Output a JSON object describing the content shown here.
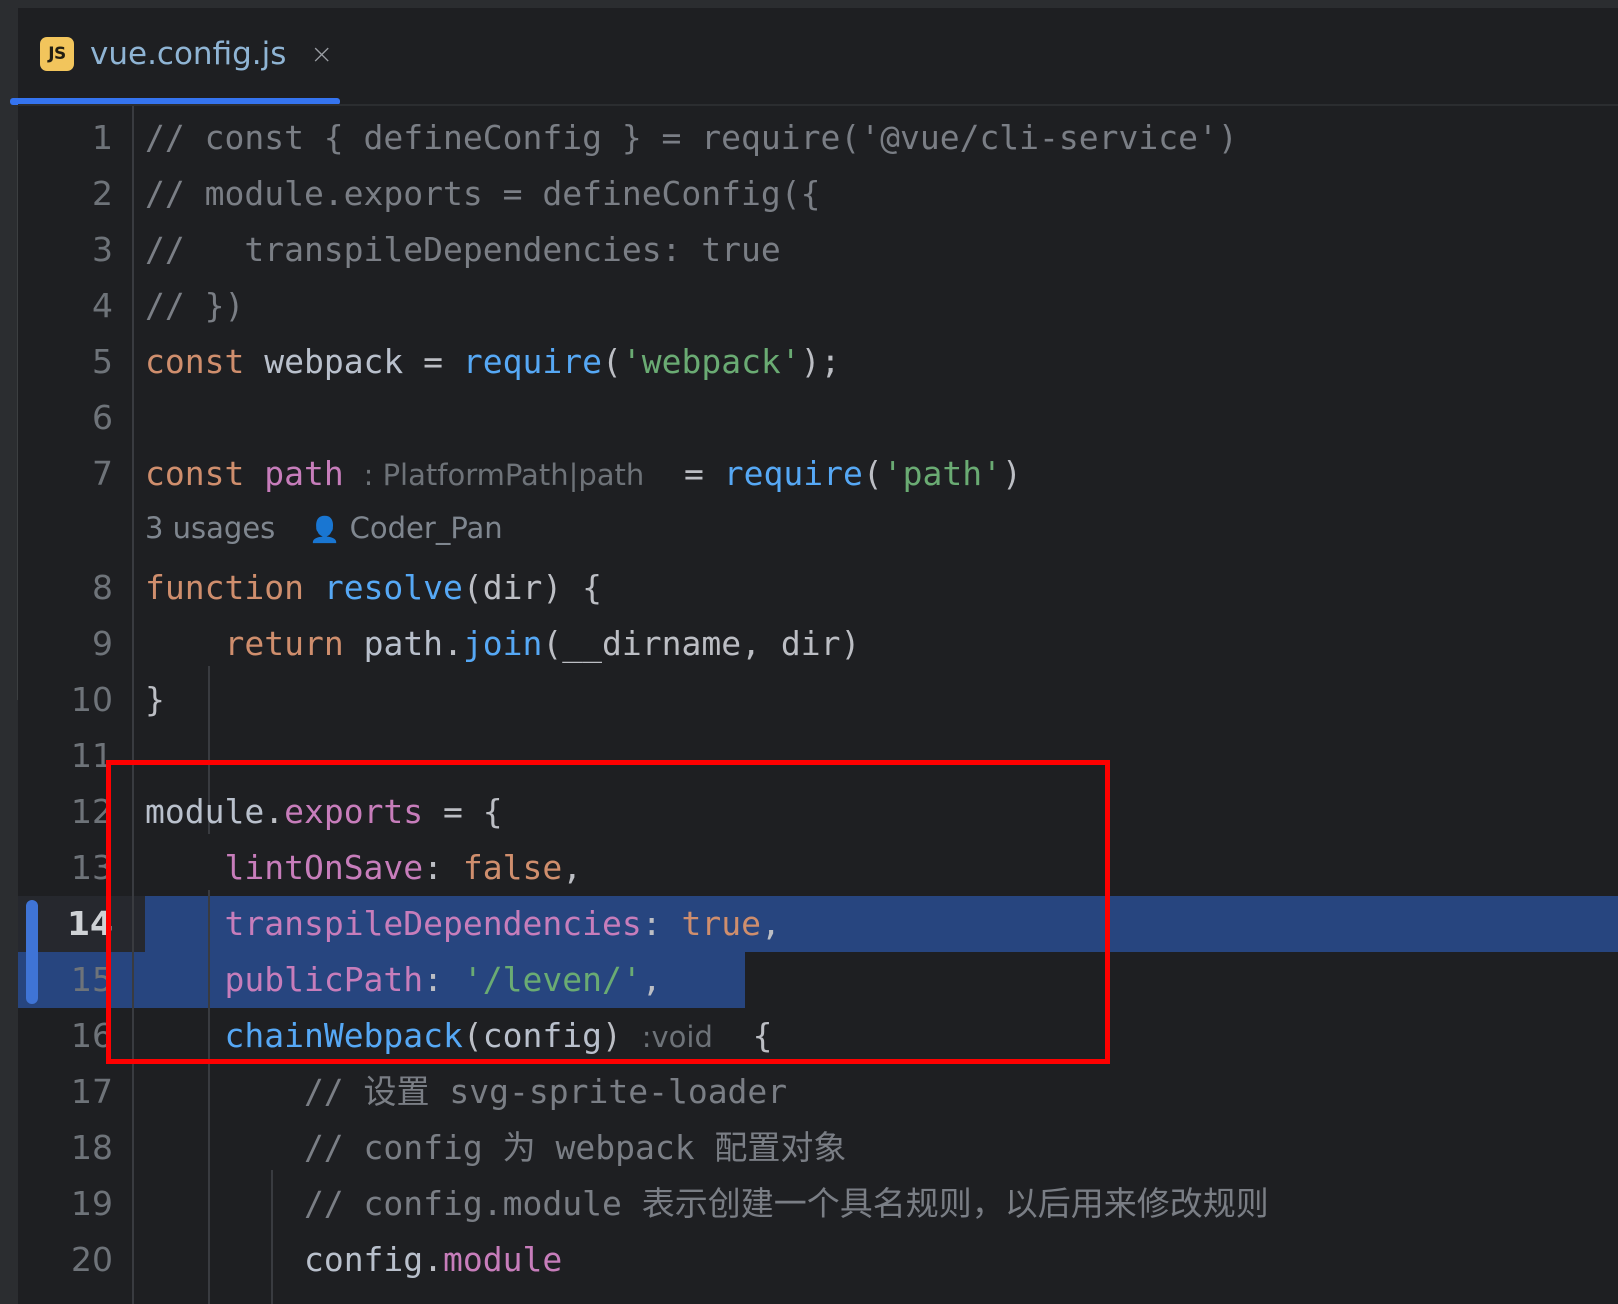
{
  "window": {
    "app": "IntelliJ IDEA / WebStorm code editor",
    "theme_background": "#1e1f22",
    "accent": "#3574f0"
  },
  "tab": {
    "icon_label": "JS",
    "icon_name": "js-file-icon",
    "title": "vue.config.js",
    "close_label": "×",
    "active": true,
    "underline_color": "#3574f0"
  },
  "editor": {
    "selection_color": "#27457f",
    "current_line": 14,
    "change_marker_lines": [
      14,
      15
    ],
    "annotation": {
      "type": "rectangle",
      "color": "#fe0000",
      "covers_lines": "12-16"
    },
    "code_vision": {
      "line": 7,
      "usages": "3 usages",
      "author_icon": "person-icon",
      "author": "Coder_Pan"
    },
    "lines": [
      {
        "n": "1",
        "text": "// const { defineConfig } = require('@vue/cli-service')"
      },
      {
        "n": "2",
        "text": "// module.exports = defineConfig({"
      },
      {
        "n": "3",
        "text": "//   transpileDependencies: true"
      },
      {
        "n": "4",
        "text": "// })"
      },
      {
        "n": "5",
        "text": "const webpack = require('webpack');"
      },
      {
        "n": "6",
        "text": ""
      },
      {
        "n": "7",
        "text": "const path : PlatformPath|path  = require('path')"
      },
      {
        "n": "8",
        "text": "function resolve(dir) {"
      },
      {
        "n": "9",
        "text": "    return path.join(__dirname, dir)"
      },
      {
        "n": "10",
        "text": "}"
      },
      {
        "n": "11",
        "text": ""
      },
      {
        "n": "12",
        "text": "module.exports = {"
      },
      {
        "n": "13",
        "text": "    lintOnSave: false,"
      },
      {
        "n": "14",
        "text": "    transpileDependencies: true,"
      },
      {
        "n": "15",
        "text": "    publicPath: '/leven/',"
      },
      {
        "n": "16",
        "text": "    chainWebpack(config) :void  {"
      },
      {
        "n": "17",
        "text": "        // 设置 svg-sprite-loader"
      },
      {
        "n": "18",
        "text": "        // config 为 webpack 配置对象"
      },
      {
        "n": "19",
        "text": "        // config.module 表示创建一个具名规则，以后用来修改规则"
      },
      {
        "n": "20",
        "text": "        config.module"
      }
    ],
    "inlay_hints": [
      {
        "line": 7,
        "text": ": PlatformPath|path"
      },
      {
        "line": 16,
        "text": ":void"
      }
    ]
  }
}
